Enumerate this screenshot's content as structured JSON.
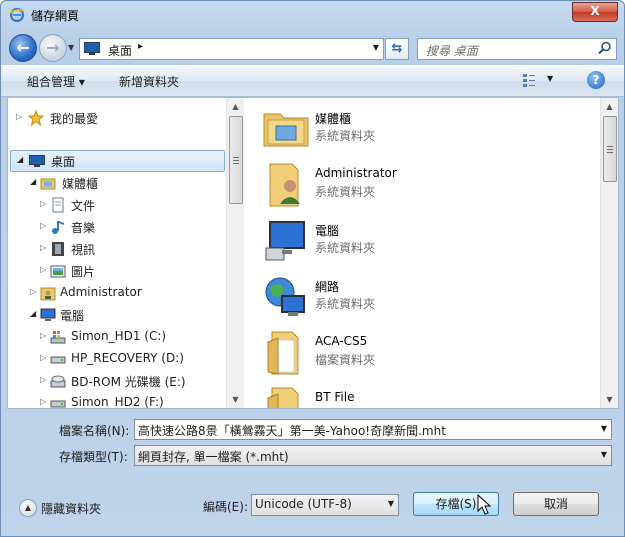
{
  "window": {
    "title": "儲存網頁",
    "close_label": "X"
  },
  "address": {
    "path": "桌面",
    "separator": "▸",
    "search_placeholder": "搜尋 桌面"
  },
  "toolbar": {
    "organize_label": "組合管理 ▾",
    "new_folder_label": "新增資料夾",
    "help_label": "?"
  },
  "tree": [
    {
      "label": "我的最愛",
      "icon": "star-icon"
    },
    {
      "label": "桌面",
      "icon": "desktop-icon",
      "selected": true
    },
    {
      "label": "媒體櫃",
      "icon": "library-icon"
    },
    {
      "label": "文件",
      "icon": "document-icon"
    },
    {
      "label": "音樂",
      "icon": "music-icon"
    },
    {
      "label": "視訊",
      "icon": "video-icon"
    },
    {
      "label": "圖片",
      "icon": "picture-icon"
    },
    {
      "label": "Administrator",
      "icon": "user-folder-icon"
    },
    {
      "label": "電腦",
      "icon": "computer-icon"
    },
    {
      "label": "Simon_HD1 (C:)",
      "icon": "system-drive-icon"
    },
    {
      "label": "HP_RECOVERY (D:)",
      "icon": "drive-icon"
    },
    {
      "label": "BD-ROM 光碟機 (E:)",
      "icon": "optical-drive-icon"
    },
    {
      "label": "Simon_HD2 (F:)",
      "icon": "drive-icon"
    }
  ],
  "files": [
    {
      "name": "媒體櫃",
      "type": "系統資料夾",
      "icon": "library-folder-icon"
    },
    {
      "name": "Administrator",
      "type": "系統資料夾",
      "icon": "user-folder-icon"
    },
    {
      "name": "電腦",
      "type": "系統資料夾",
      "icon": "computer-icon"
    },
    {
      "name": "網路",
      "type": "系統資料夾",
      "icon": "network-icon"
    },
    {
      "name": "ACA-CS5",
      "type": "檔案資料夾",
      "icon": "folder-icon"
    },
    {
      "name": "BT File",
      "type": "",
      "icon": "folder-icon"
    }
  ],
  "form": {
    "filename_label": "檔案名稱(N):",
    "filename_value": "高快速公路8景「橫鶯霧天」第一美-Yahoo!奇摩新聞.mht",
    "filetype_label": "存檔類型(T):",
    "filetype_value": "網頁封存, 單一檔案 (*.mht)",
    "encoding_label": "編碼(E):",
    "encoding_value": "Unicode (UTF-8)",
    "save_label": "存檔(S)",
    "cancel_label": "取消",
    "hide_folders_label": "隱藏資料夾"
  },
  "colors": {
    "accent": "#3c7fb1",
    "close": "#c13a25",
    "selection": "#d2e4f7"
  }
}
